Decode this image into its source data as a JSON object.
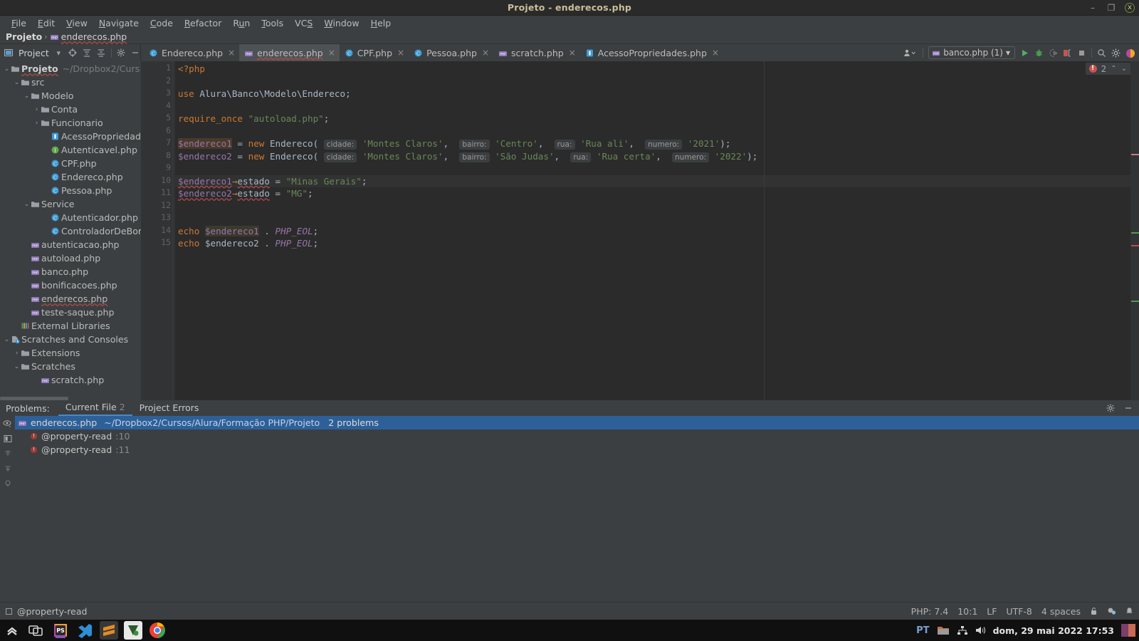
{
  "window": {
    "title": "Projeto - enderecos.php",
    "minimize": "–",
    "restore": "❐",
    "close": "x"
  },
  "menubar": {
    "items": [
      {
        "label": "File"
      },
      {
        "label": "Edit"
      },
      {
        "label": "View"
      },
      {
        "label": "Navigate"
      },
      {
        "label": "Code"
      },
      {
        "label": "Refactor"
      },
      {
        "label": "Run"
      },
      {
        "label": "Tools"
      },
      {
        "label": "VCS"
      },
      {
        "label": "Window"
      },
      {
        "label": "Help"
      }
    ]
  },
  "breadcrumb": {
    "project": "Projeto",
    "separator": "›",
    "file": "enderecos.php"
  },
  "toolbar": {
    "project_label": "Project",
    "dropdown": "▾",
    "run_config": "banco.php (1)",
    "run_config_caret": "▾"
  },
  "tabs": [
    {
      "label": "Endereco.php",
      "icon": "php-class-icon",
      "active": false,
      "close": "×"
    },
    {
      "label": "enderecos.php",
      "icon": "php-file-icon",
      "active": true,
      "close": "×"
    },
    {
      "label": "CPF.php",
      "icon": "php-class-icon",
      "active": false,
      "close": "×"
    },
    {
      "label": "Pessoa.php",
      "icon": "php-class-icon",
      "active": false,
      "close": "×"
    },
    {
      "label": "scratch.php",
      "icon": "php-file-icon",
      "active": false,
      "close": "×"
    },
    {
      "label": "AcessoPropriedades.php",
      "icon": "php-trait-icon",
      "active": false,
      "close": "×"
    }
  ],
  "tree": {
    "items": [
      {
        "label": "Projeto",
        "sub": "~/Dropbox2/Curs",
        "indent": 0,
        "arrow": "⌄",
        "icon": "folder-icon",
        "bold": true,
        "squiggle": true
      },
      {
        "label": "src",
        "sub": "",
        "indent": 1,
        "arrow": "⌄",
        "icon": "folder-icon",
        "bold": false
      },
      {
        "label": "Modelo",
        "sub": "",
        "indent": 2,
        "arrow": "⌄",
        "icon": "folder-icon",
        "bold": false
      },
      {
        "label": "Conta",
        "sub": "",
        "indent": 3,
        "arrow": "›",
        "icon": "folder-icon",
        "bold": false
      },
      {
        "label": "Funcionario",
        "sub": "",
        "indent": 3,
        "arrow": "›",
        "icon": "folder-icon",
        "bold": false
      },
      {
        "label": "AcessoPropriedades",
        "sub": "",
        "indent": 4,
        "arrow": "",
        "icon": "php-trait-icon",
        "bold": false
      },
      {
        "label": "Autenticavel.php",
        "sub": "",
        "indent": 4,
        "arrow": "",
        "icon": "php-interface-icon",
        "bold": false
      },
      {
        "label": "CPF.php",
        "sub": "",
        "indent": 4,
        "arrow": "",
        "icon": "php-class-icon",
        "bold": false
      },
      {
        "label": "Endereco.php",
        "sub": "",
        "indent": 4,
        "arrow": "",
        "icon": "php-class-icon",
        "bold": false
      },
      {
        "label": "Pessoa.php",
        "sub": "",
        "indent": 4,
        "arrow": "",
        "icon": "php-class-icon",
        "bold": false
      },
      {
        "label": "Service",
        "sub": "",
        "indent": 2,
        "arrow": "⌄",
        "icon": "folder-icon",
        "bold": false
      },
      {
        "label": "Autenticador.php",
        "sub": "",
        "indent": 4,
        "arrow": "",
        "icon": "php-class-icon",
        "bold": false
      },
      {
        "label": "ControladorDeBonifi",
        "sub": "",
        "indent": 4,
        "arrow": "",
        "icon": "php-class-icon",
        "bold": false
      },
      {
        "label": "autenticacao.php",
        "sub": "",
        "indent": 2,
        "arrow": "",
        "icon": "php-file-icon",
        "bold": false
      },
      {
        "label": "autoload.php",
        "sub": "",
        "indent": 2,
        "arrow": "",
        "icon": "php-file-icon",
        "bold": false
      },
      {
        "label": "banco.php",
        "sub": "",
        "indent": 2,
        "arrow": "",
        "icon": "php-file-icon",
        "bold": false
      },
      {
        "label": "bonificacoes.php",
        "sub": "",
        "indent": 2,
        "arrow": "",
        "icon": "php-file-icon",
        "bold": false
      },
      {
        "label": "enderecos.php",
        "sub": "",
        "indent": 2,
        "arrow": "",
        "icon": "php-file-icon",
        "bold": false,
        "squiggle": true
      },
      {
        "label": "teste-saque.php",
        "sub": "",
        "indent": 2,
        "arrow": "",
        "icon": "php-file-icon",
        "bold": false
      },
      {
        "label": "External Libraries",
        "sub": "",
        "indent": 1,
        "arrow": "",
        "icon": "libraries-icon",
        "bold": false
      },
      {
        "label": "Scratches and Consoles",
        "sub": "",
        "indent": 0,
        "arrow": "⌄",
        "icon": "scratches-icon",
        "bold": false
      },
      {
        "label": "Extensions",
        "sub": "",
        "indent": 1,
        "arrow": "›",
        "icon": "folder-icon",
        "bold": false
      },
      {
        "label": "Scratches",
        "sub": "",
        "indent": 1,
        "arrow": "⌄",
        "icon": "folder-icon",
        "bold": false
      },
      {
        "label": "scratch.php",
        "sub": "",
        "indent": 3,
        "arrow": "",
        "icon": "php-file-icon",
        "bold": false
      }
    ]
  },
  "editor": {
    "line_numbers": [
      "1",
      "2",
      "3",
      "4",
      "5",
      "6",
      "7",
      "8",
      "9",
      "10",
      "11",
      "12",
      "13",
      "14",
      "15"
    ],
    "code_lines": [
      "<?php",
      "",
      "use Alura\\Banco\\Modelo\\Endereco;",
      "",
      "require_once \"autoload.php\";",
      "",
      "$endereco1 = new Endereco( cidade: 'Montes Claros', bairro: 'Centro', rua: 'Rua ali', numero: '2021');",
      "$endereco2 = new Endereco( cidade: 'Montes Claros', bairro: 'São Judas', rua: 'Rua certa', numero: '2022');",
      "",
      "$endereco1->estado = \"Minas Gerais\";",
      "$endereco2->estado = \"MG\";",
      "",
      "",
      "echo $endereco1 . PHP_EOL;",
      "echo $endereco2 . PHP_EOL;"
    ],
    "inspection_count": "2",
    "inspection_up": "⌃",
    "inspection_down": "⌄"
  },
  "problems": {
    "panel_label": "Problems:",
    "tabs": [
      {
        "label": "Current File",
        "count": "2",
        "active": true
      },
      {
        "label": "Project Errors",
        "count": "",
        "active": false
      }
    ],
    "rows": [
      {
        "type": "file",
        "filename": "enderecos.php",
        "path": "~/Dropbox2/Cursos/Alura/Formação PHP/Projeto",
        "count": "2 problems",
        "selected": true
      },
      {
        "type": "problem",
        "message": "@property-read",
        "line": ":10",
        "selected": false
      },
      {
        "type": "problem",
        "message": "@property-read",
        "line": ":11",
        "selected": false
      }
    ]
  },
  "statusbar": {
    "message": "@property-read",
    "items": [
      {
        "label": "PHP: 7.4",
        "name": "php-version"
      },
      {
        "label": "10:1",
        "name": "caret-position"
      },
      {
        "label": "LF",
        "name": "line-separator"
      },
      {
        "label": "UTF-8",
        "name": "file-encoding"
      },
      {
        "label": "4 spaces",
        "name": "indent-setting"
      }
    ]
  },
  "taskbar": {
    "language": "PT",
    "clock": "dom, 29 mai 2022 17:53"
  },
  "colors": {
    "accent_blue": "#4a88c7",
    "selection_blue": "#2d6099",
    "error_red": "#c75450",
    "keyword_orange": "#cc7832",
    "string_green": "#6a8759",
    "variable_purple": "#9876aa",
    "panel_bg": "#3c3f41",
    "editor_bg": "#2b2b2b"
  }
}
